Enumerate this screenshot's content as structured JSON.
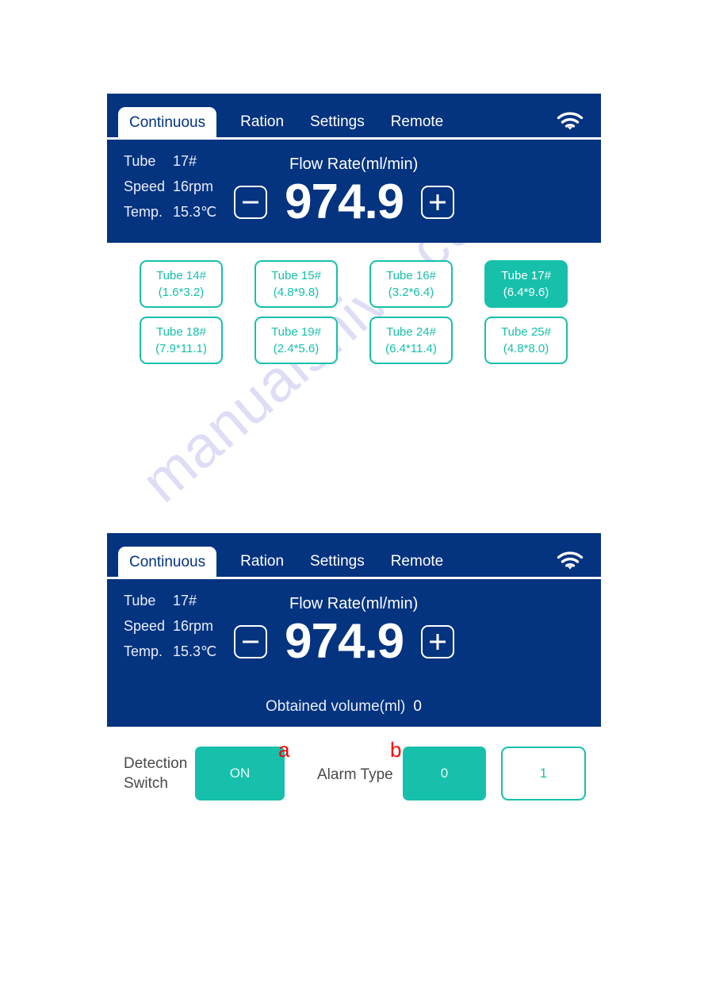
{
  "watermark": {
    "text": "manualshive.com"
  },
  "colors": {
    "panel_navy": "#04337f",
    "accent_teal": "#17c0ab",
    "marker_red": "#ff0000",
    "label_gray": "#4a4a4a"
  },
  "tabs": [
    {
      "label": "Continuous",
      "active": true
    },
    {
      "label": "Ration",
      "active": false
    },
    {
      "label": "Settings",
      "active": false
    },
    {
      "label": "Remote",
      "active": false
    }
  ],
  "status_icon": "wifi-icon",
  "readouts": [
    {
      "label": "Tube",
      "value": "17#"
    },
    {
      "label": "Speed",
      "value": "16rpm"
    },
    {
      "label": "Temp.",
      "value": "15.3℃"
    }
  ],
  "flow": {
    "label": "Flow Rate(ml/min)",
    "value": "974.9",
    "decrement": "−",
    "increment": "+"
  },
  "obtained": {
    "label": "Obtained volume(ml)",
    "value": "0"
  },
  "tubes": [
    {
      "name": "Tube  14#",
      "size": "(1.6*3.2)",
      "selected": false
    },
    {
      "name": "Tube  15#",
      "size": "(4.8*9.8)",
      "selected": false
    },
    {
      "name": "Tube  16#",
      "size": "(3.2*6.4)",
      "selected": false
    },
    {
      "name": "Tube  17#",
      "size": "(6.4*9.6)",
      "selected": true
    },
    {
      "name": "Tube  18#",
      "size": "(7.9*11.1)",
      "selected": false
    },
    {
      "name": "Tube  19#",
      "size": "(2.4*5.6)",
      "selected": false
    },
    {
      "name": "Tube  24#",
      "size": "(6.4*11.4)",
      "selected": false
    },
    {
      "name": "Tube  25#",
      "size": "(4.8*8.0)",
      "selected": false
    }
  ],
  "controls": {
    "detection_switch_label": "Detection Switch",
    "detection_switch_value": "ON",
    "alarm_type_label": "Alarm Type",
    "alarm_type_selected": "0",
    "alarm_type_other": "1",
    "marker_a": "a",
    "marker_b": "b"
  }
}
